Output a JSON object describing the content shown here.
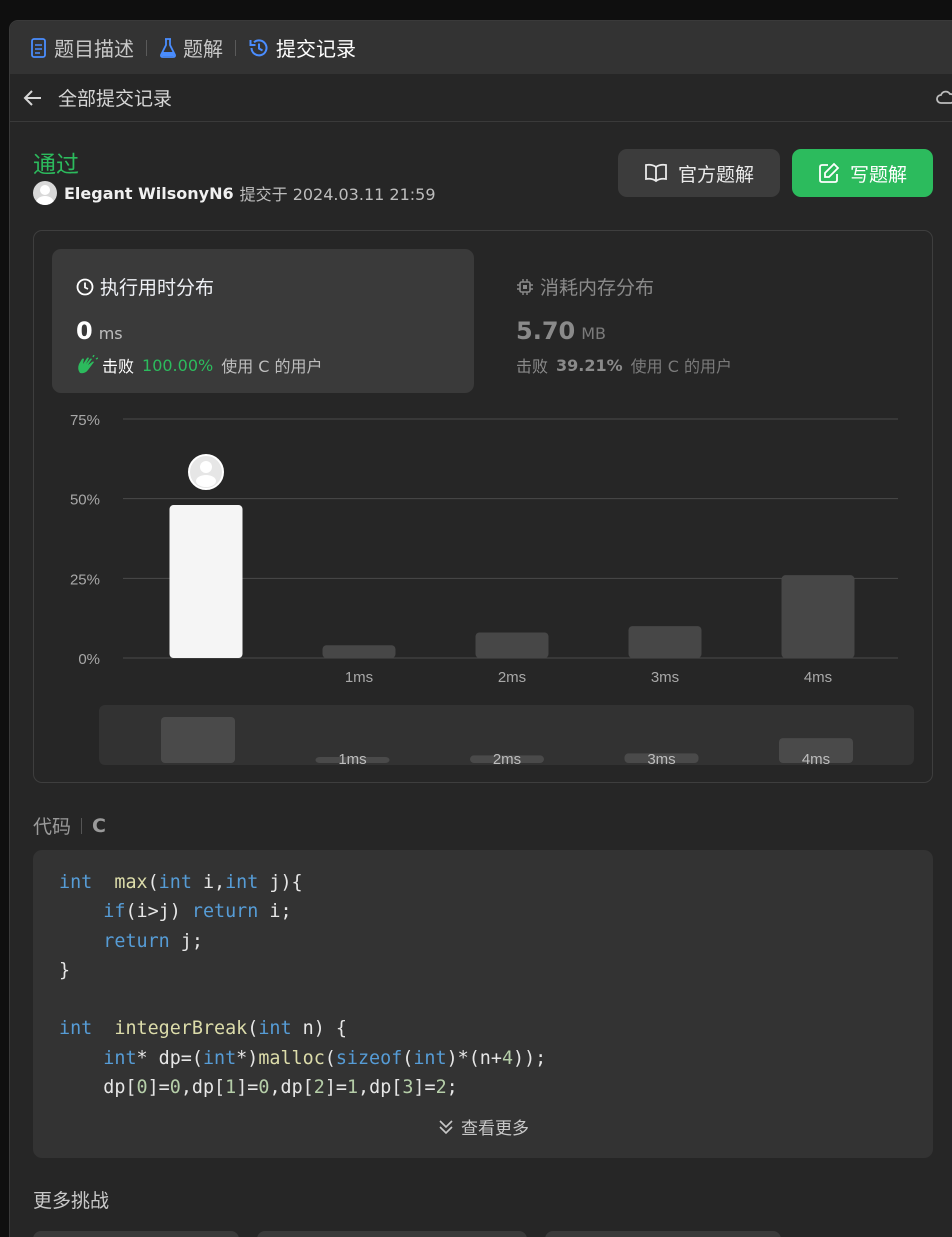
{
  "tabs": [
    {
      "label": "题目描述",
      "icon": "doc-icon"
    },
    {
      "label": "题解",
      "icon": "flask-icon"
    },
    {
      "label": "提交记录",
      "icon": "history-icon",
      "active": true
    }
  ],
  "subheader": {
    "back_label": "全部提交记录"
  },
  "submission": {
    "status": "通过",
    "user": "Elegant WilsonyN6",
    "submitted_text": "提交于 2024.03.11 21:59"
  },
  "buttons": {
    "official": "官方题解",
    "write": "写题解"
  },
  "runtime": {
    "title": "执行用时分布",
    "value": "0",
    "unit": "ms",
    "beat_word": "击败",
    "percent": "100.00%",
    "suffix": "使用 C 的用户"
  },
  "memory": {
    "title": "消耗内存分布",
    "value": "5.70",
    "unit": "MB",
    "beat_word": "击败",
    "percent": "39.21%",
    "suffix": "使用 C 的用户"
  },
  "chart_data": {
    "type": "bar",
    "categories": [
      "",
      "1ms",
      "2ms",
      "3ms",
      "4ms"
    ],
    "values": [
      48,
      4,
      8,
      10,
      26
    ],
    "yticks": [
      "0%",
      "25%",
      "50%",
      "75%"
    ],
    "ylim": [
      0,
      75
    ],
    "highlight_index": 0,
    "colors": {
      "highlight": "#f5f5f5",
      "bar": "#474747",
      "grid": "#4a4a4a",
      "axis_text": "#a8a8a8"
    }
  },
  "code_section": {
    "label": "代码",
    "lang": "C",
    "more": "查看更多"
  },
  "code_lines": [
    [
      [
        "kw",
        "int"
      ],
      [
        "",
        "  "
      ],
      [
        "fn",
        "max"
      ],
      [
        "",
        "("
      ],
      [
        "kw",
        "int"
      ],
      [
        "",
        " i,"
      ],
      [
        "kw",
        "int"
      ],
      [
        "",
        " j){"
      ]
    ],
    [
      [
        "",
        "    "
      ],
      [
        "kw",
        "if"
      ],
      [
        "",
        "(i>j) "
      ],
      [
        "kw",
        "return"
      ],
      [
        "",
        " i;"
      ]
    ],
    [
      [
        "",
        "    "
      ],
      [
        "kw",
        "return"
      ],
      [
        "",
        " j;"
      ]
    ],
    [
      [
        "",
        "}"
      ]
    ],
    [
      [
        "",
        ""
      ]
    ],
    [
      [
        "kw",
        "int"
      ],
      [
        "",
        "  "
      ],
      [
        "fn",
        "integerBreak"
      ],
      [
        "",
        "("
      ],
      [
        "kw",
        "int"
      ],
      [
        "",
        " n) {"
      ]
    ],
    [
      [
        "",
        "    "
      ],
      [
        "kw",
        "int"
      ],
      [
        "",
        "* dp=("
      ],
      [
        "kw",
        "int"
      ],
      [
        "",
        "*)"
      ],
      [
        "fn",
        "malloc"
      ],
      [
        "",
        "("
      ],
      [
        "kw",
        "sizeof"
      ],
      [
        "",
        "("
      ],
      [
        "kw",
        "int"
      ],
      [
        "",
        ")*(n+"
      ],
      [
        "nm",
        "4"
      ],
      [
        "",
        "));"
      ]
    ],
    [
      [
        "",
        "    dp["
      ],
      [
        "nm",
        "0"
      ],
      [
        "",
        "]="
      ],
      [
        "nm",
        "0"
      ],
      [
        "",
        ",dp["
      ],
      [
        "nm",
        "1"
      ],
      [
        "",
        "]="
      ],
      [
        "nm",
        "0"
      ],
      [
        "",
        ",dp["
      ],
      [
        "nm",
        "2"
      ],
      [
        "",
        "]="
      ],
      [
        "nm",
        "1"
      ],
      [
        "",
        ",dp["
      ],
      [
        "nm",
        "3"
      ],
      [
        "",
        "]="
      ],
      [
        "nm",
        "2"
      ],
      [
        "",
        ";"
      ]
    ]
  ],
  "more_challenges": "更多挑战"
}
